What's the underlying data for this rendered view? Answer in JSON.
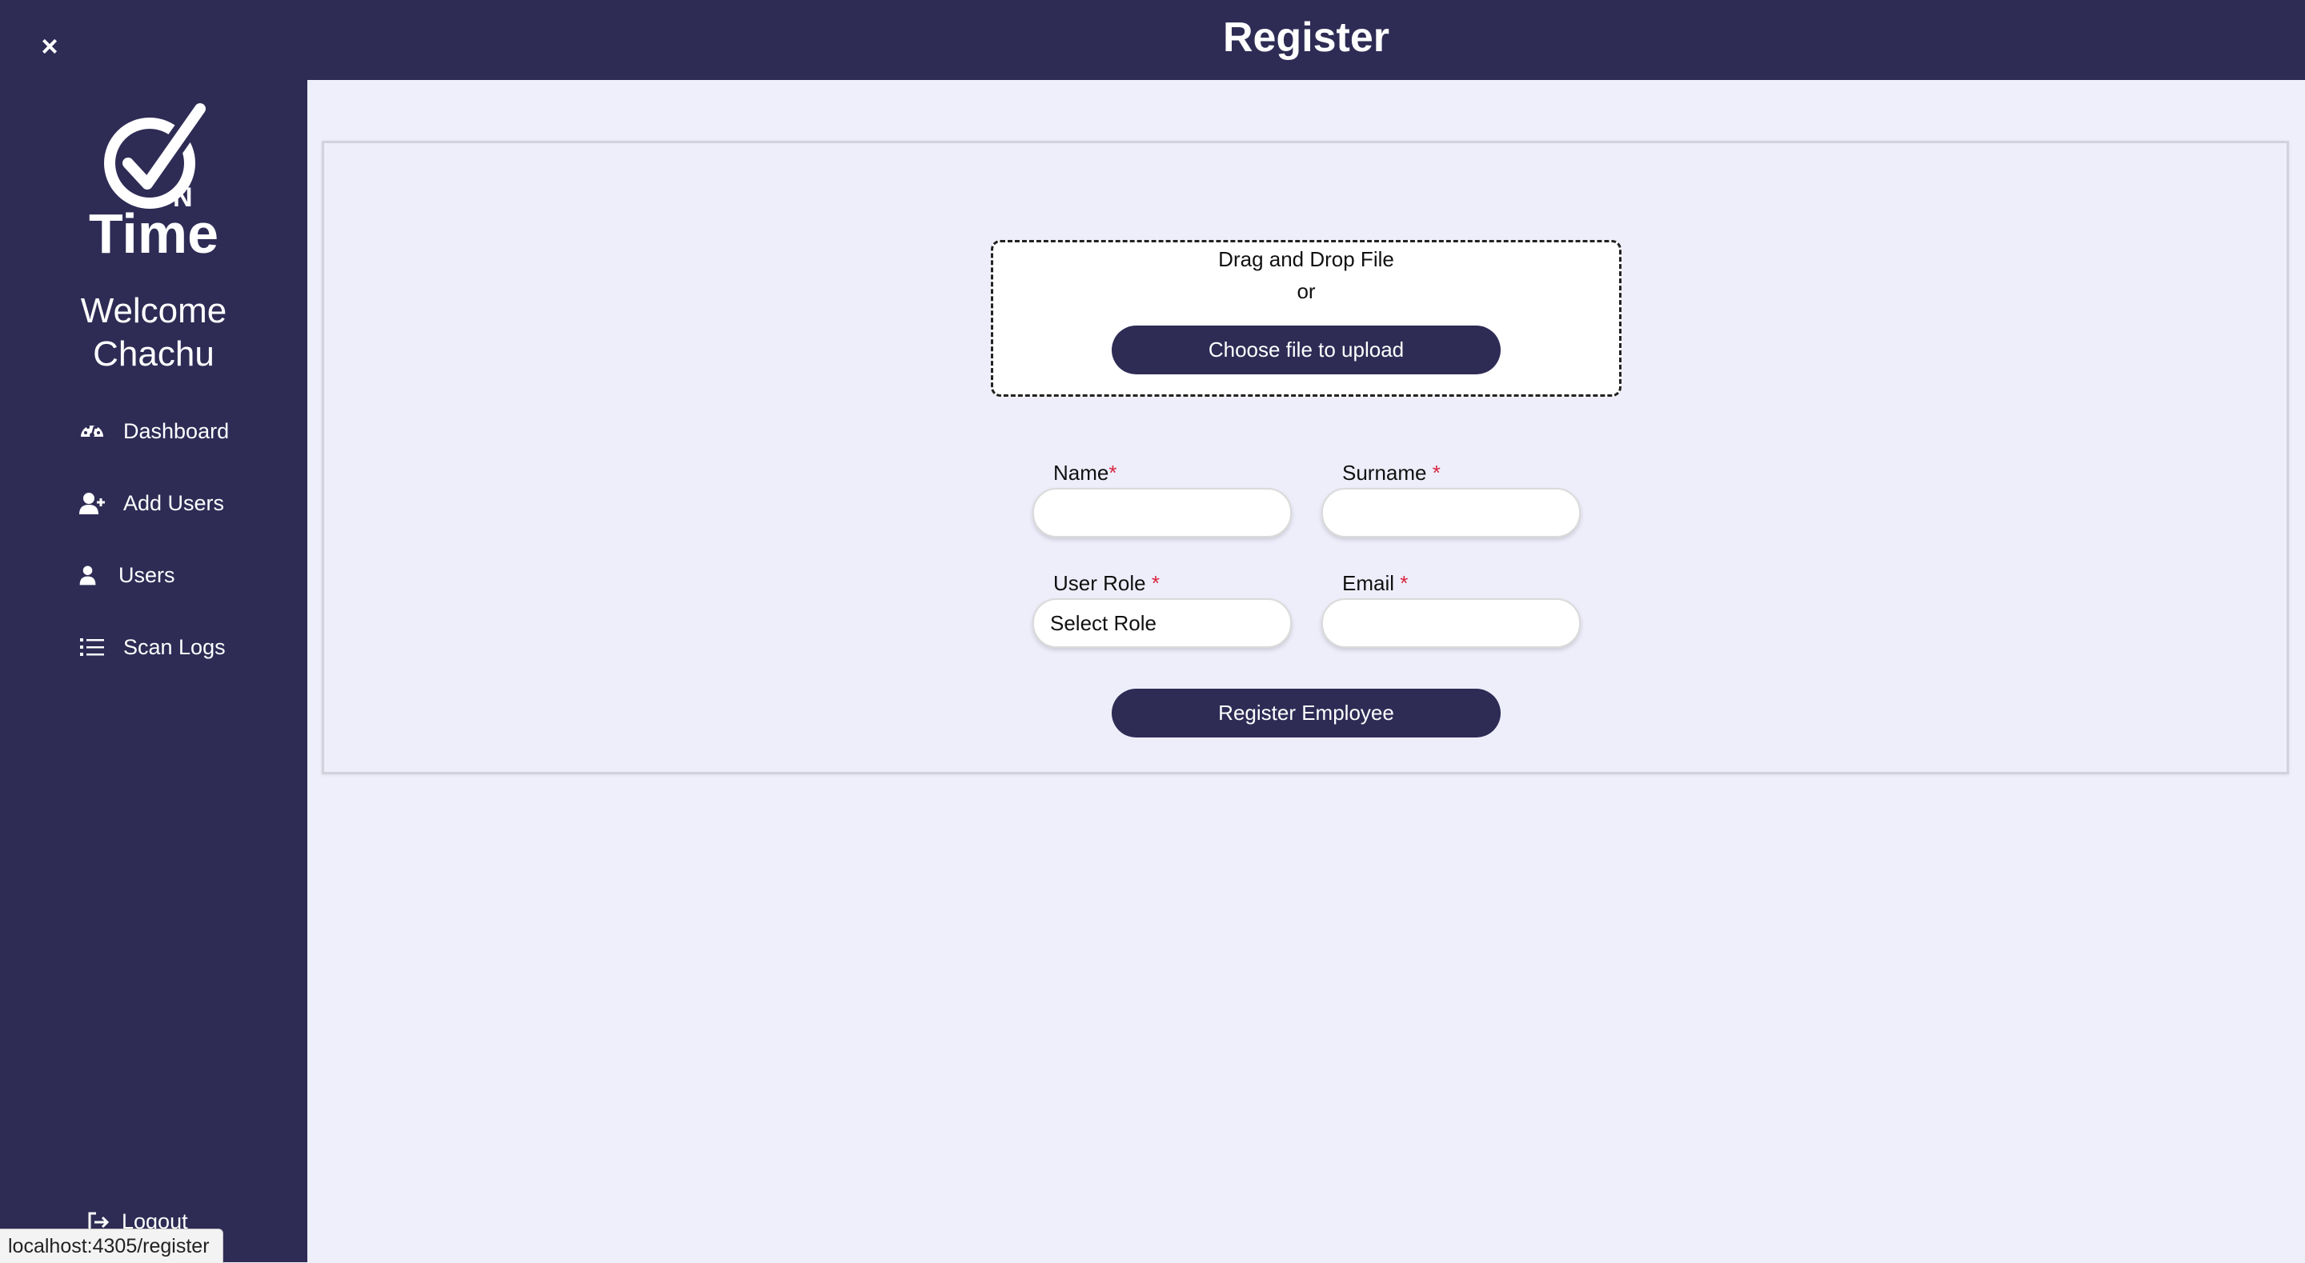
{
  "header": {
    "title": "Register"
  },
  "sidebar": {
    "close_glyph": "×",
    "logo_text": "Time",
    "logo_badge": "N",
    "welcome_line1": "Welcome",
    "welcome_line2": "Chachu",
    "items": [
      {
        "label": "Dashboard",
        "icon": "dashboard-gauge-icon"
      },
      {
        "label": "Add Users",
        "icon": "user-plus-icon"
      },
      {
        "label": "Users",
        "icon": "user-icon"
      },
      {
        "label": "Scan Logs",
        "icon": "list-icon"
      }
    ],
    "logout_label": "Logout"
  },
  "upload": {
    "drag_text": "Drag and Drop File",
    "or_text": "or",
    "button_label": "Choose file to upload"
  },
  "form": {
    "name_label": "Name",
    "surname_label": "Surname",
    "role_label": "User Role",
    "email_label": "Email",
    "required_mark": "*",
    "role_value": "Select Role",
    "submit_label": "Register Employee"
  },
  "status_bar": {
    "url": "localhost:4305/register"
  },
  "colors": {
    "sidebar_bg": "#2e2c55",
    "page_bg": "#efeffb",
    "button_bg": "#2e2c55",
    "required": "#d9263d"
  }
}
